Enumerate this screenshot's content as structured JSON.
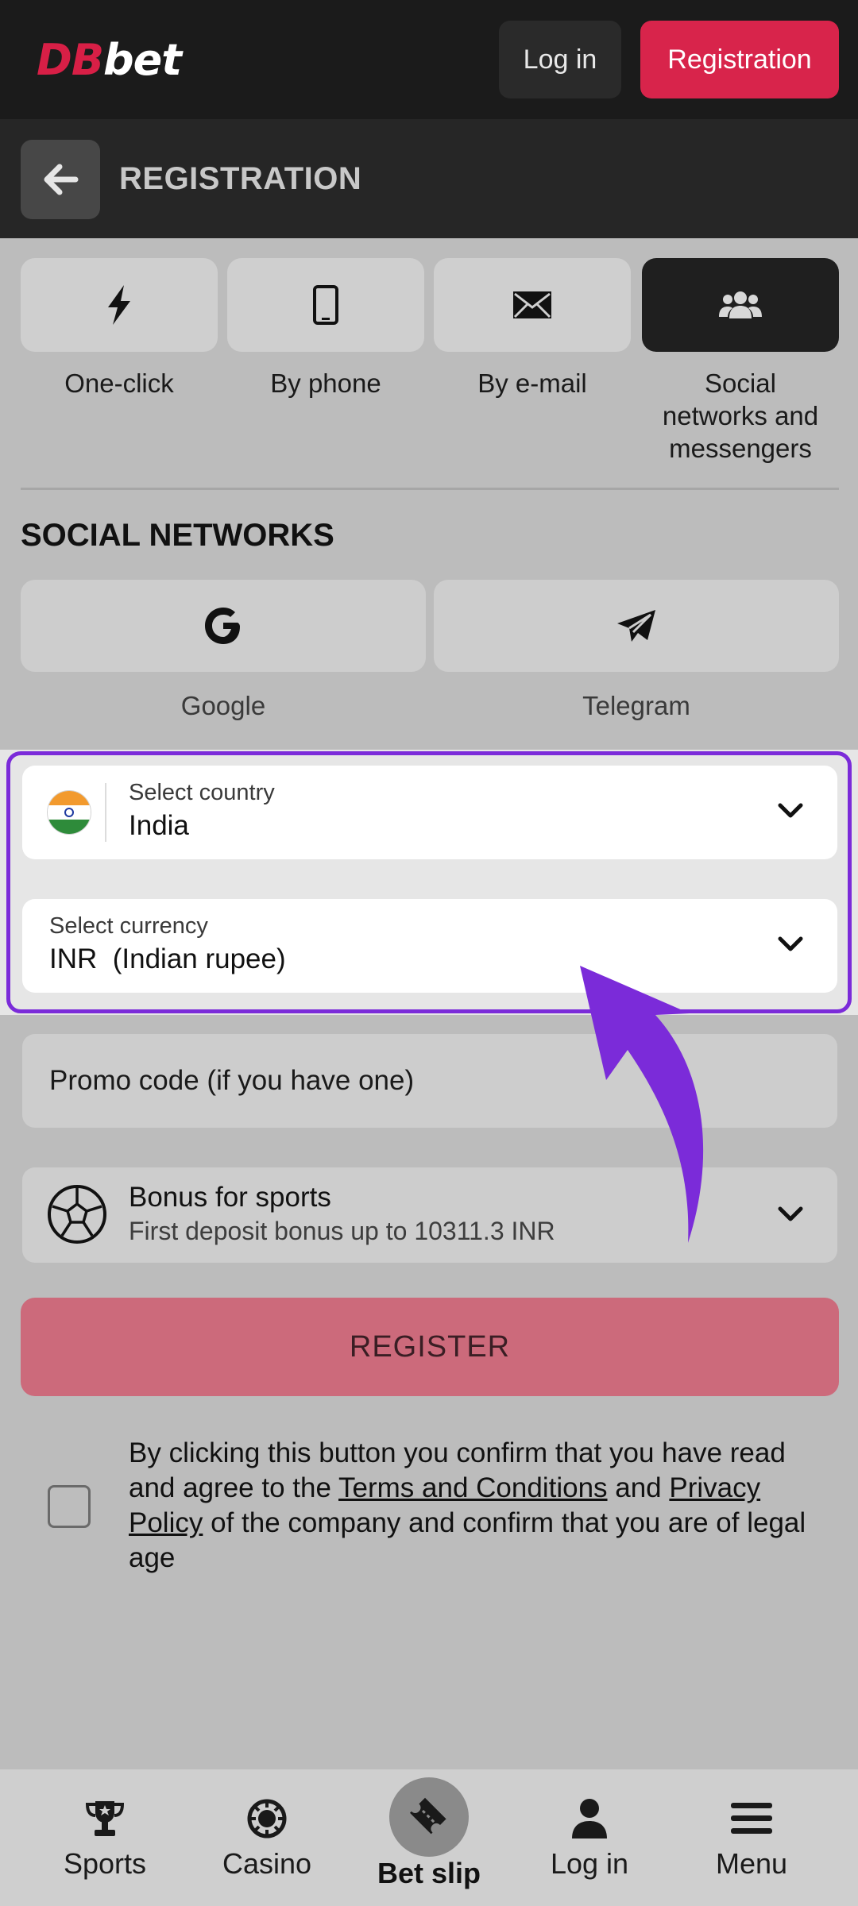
{
  "header": {
    "logo_db": "DB",
    "logo_bet": "bet",
    "login_label": "Log in",
    "registration_label": "Registration"
  },
  "subheader": {
    "title": "REGISTRATION",
    "back_icon": "arrow-left-icon"
  },
  "methods": [
    {
      "label": "One-click",
      "icon": "lightning-icon",
      "active": false
    },
    {
      "label": "By phone",
      "icon": "phone-icon",
      "active": false
    },
    {
      "label": "By e-mail",
      "icon": "envelope-icon",
      "active": false
    },
    {
      "label": "Social networks and messengers",
      "icon": "users-icon",
      "active": true
    }
  ],
  "social": {
    "title": "SOCIAL NETWORKS",
    "google_label": "Google",
    "telegram_label": "Telegram"
  },
  "country": {
    "caption": "Select country",
    "value": "India"
  },
  "currency": {
    "caption": "Select currency",
    "code": "INR",
    "name": "(Indian rupee)"
  },
  "promo": {
    "placeholder": "Promo code (if you have one)"
  },
  "bonus": {
    "title": "Bonus for sports",
    "subtitle": "First deposit bonus up to 10311.3 INR"
  },
  "register_label": "REGISTER",
  "consent": {
    "part1": "By clicking this button you confirm that you have read and agree to the ",
    "terms": "Terms and Conditions",
    "part2": " and ",
    "privacy": "Privacy Policy",
    "part3": " of the company and confirm that you are of legal age"
  },
  "bottom_nav": {
    "sports": "Sports",
    "casino": "Casino",
    "betslip": "Bet slip",
    "login": "Log in",
    "menu": "Menu"
  },
  "colors": {
    "brand_red": "#d8244b",
    "highlight_purple": "#7b2bd9",
    "register_disabled": "#cc6a7b"
  }
}
